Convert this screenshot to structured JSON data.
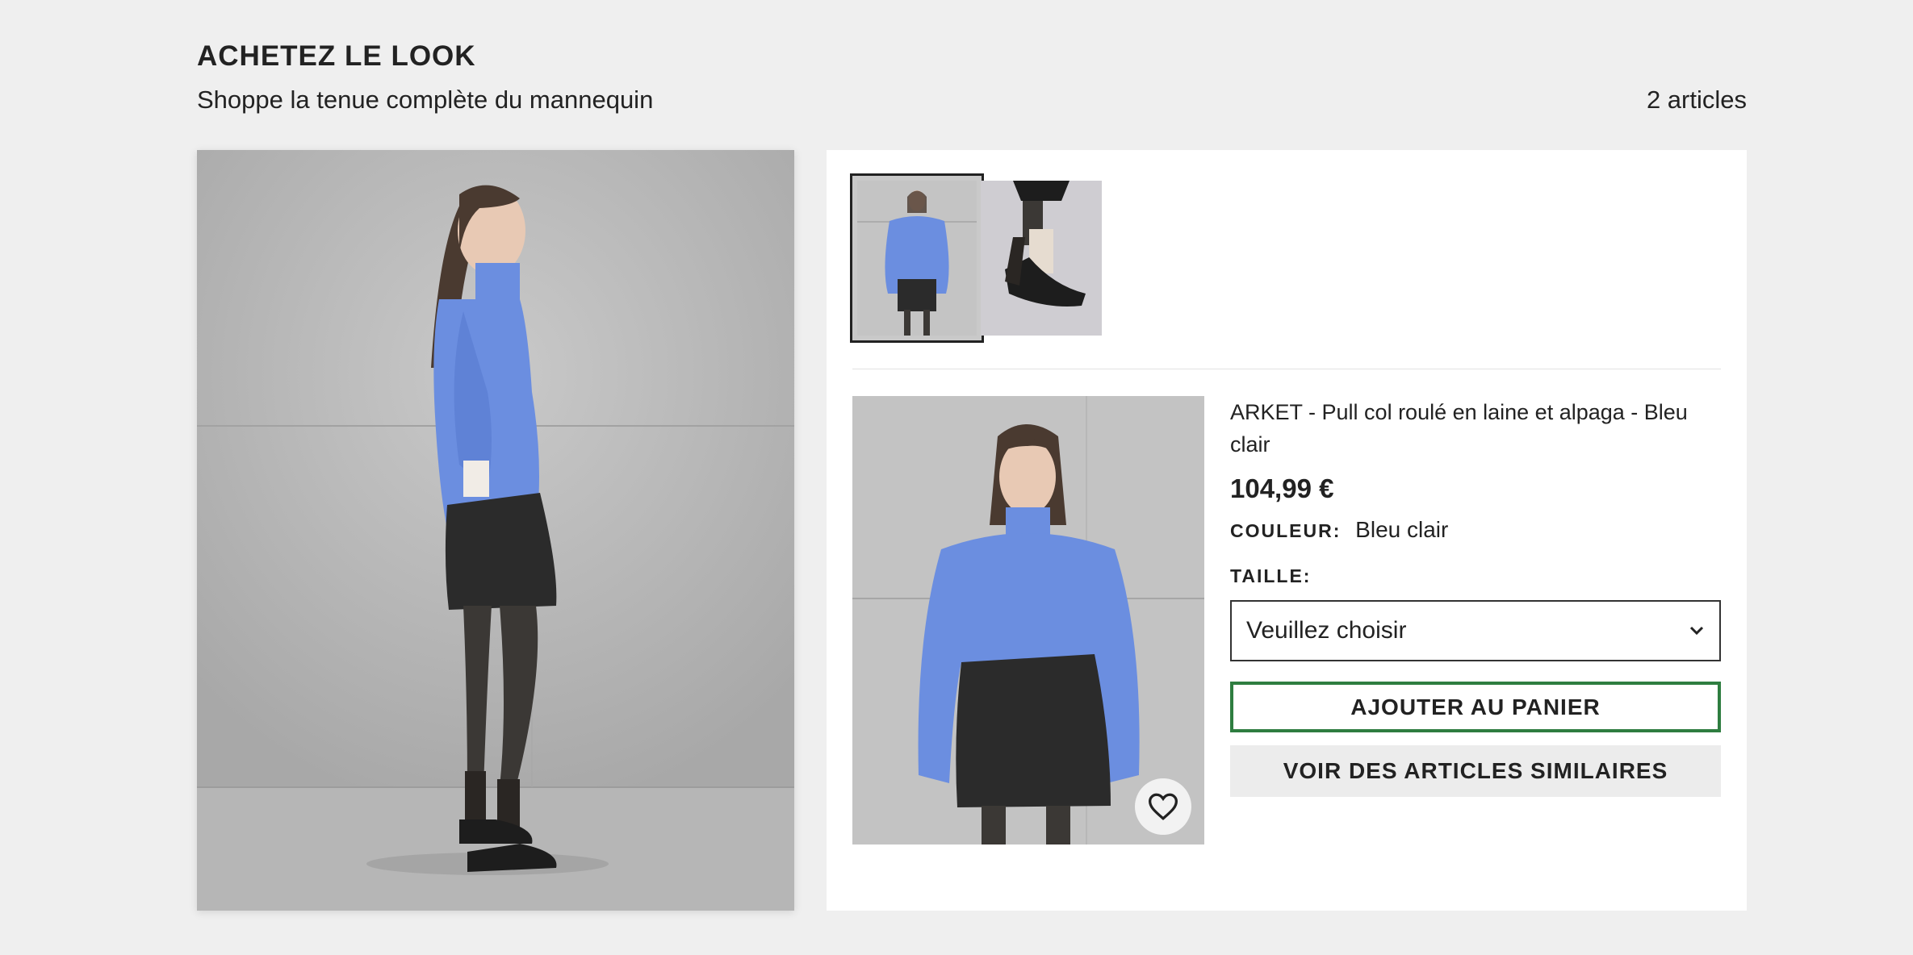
{
  "header": {
    "title": "ACHETEZ LE LOOK",
    "subtitle": "Shoppe la tenue complète du mannequin",
    "count": "2 articles"
  },
  "thumbnails": [
    {
      "name": "Pull col roulé",
      "active": true
    },
    {
      "name": "Mocassins",
      "active": false
    }
  ],
  "product": {
    "name": "ARKET - Pull col roulé en laine et alpaga - Bleu clair",
    "price": "104,99 €",
    "color_label": "COULEUR:",
    "color_value": "Bleu clair",
    "size_label": "TAILLE:",
    "size_placeholder": "Veuillez choisir",
    "add_to_cart": "AJOUTER AU PANIER",
    "see_similar": "VOIR DES ARTICLES SIMILAIRES"
  },
  "icons": {
    "favorite": "heart-icon",
    "dropdown": "chevron-down-icon"
  },
  "colors": {
    "background": "#efefef",
    "panel": "#ffffff",
    "cart_border": "#2e7d40",
    "sweater": "#6b8ee0",
    "skirt": "#2b2b2b"
  }
}
